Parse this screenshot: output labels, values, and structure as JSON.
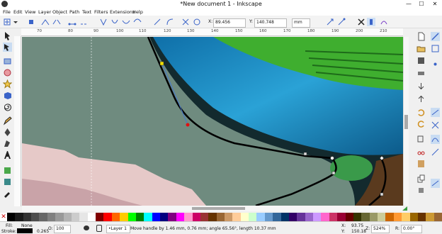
{
  "window": {
    "title": "*New document 1 - Inkscape",
    "minimize": "—",
    "maximize": "☐",
    "close": "✕"
  },
  "menu": [
    "File",
    "Edit",
    "View",
    "Layer",
    "Object",
    "Path",
    "Text",
    "Filters",
    "Extensions",
    "Help"
  ],
  "toolbar": {
    "x_label": "X:",
    "x_value": "89.456",
    "y_label": "Y:",
    "y_value": "140.748",
    "unit": "mm"
  },
  "ruler": {
    "ticks": [
      "70",
      "80",
      "90",
      "100",
      "110",
      "120",
      "130",
      "140",
      "150",
      "160",
      "170",
      "180",
      "190",
      "200",
      "210"
    ]
  },
  "status": {
    "fill_label": "Fill:",
    "fill_value": "None",
    "stroke_label": "Stroke:",
    "stroke_value": "0.265",
    "opacity_label": "O:",
    "opacity_value": "100",
    "layer": "•Layer 1",
    "message": "Move handle by 1.46 mm, 0.76 mm; angle 65.56°, length 10.37 mm",
    "x_label": "X:",
    "x_value": "93.75",
    "y_label": "Y:",
    "y_value": "150.18",
    "z_label": "Z:",
    "z_value": "524%",
    "r_label": "R:",
    "r_value": "0.00°"
  },
  "colors": {
    "accent": "#3a63c8",
    "canvas_bg": "#6f8b7f",
    "bird_blue": "#1f8fbf",
    "bird_green": "#3fae2f"
  },
  "palette": [
    "#000000",
    "#1a1a1a",
    "#333333",
    "#4d4d4d",
    "#666666",
    "#808080",
    "#999999",
    "#b3b3b3",
    "#cccccc",
    "#e6e6e6",
    "#ffffff",
    "#800000",
    "#ff0000",
    "#ff6600",
    "#ffcc00",
    "#00ff00",
    "#008000",
    "#00ffff",
    "#0000ff",
    "#000080",
    "#800080",
    "#ff00ff",
    "#ff99cc",
    "#cc0066",
    "#993333",
    "#663300",
    "#996633",
    "#cc9966",
    "#ffcc99",
    "#ffffcc",
    "#ccffcc",
    "#99ccff",
    "#6699cc",
    "#336699",
    "#003366",
    "#330066",
    "#663399",
    "#9966cc",
    "#cc99ff",
    "#ff66cc",
    "#cc3366",
    "#990033",
    "#660000",
    "#333300",
    "#666633",
    "#999966",
    "#cccc99",
    "#cc6600",
    "#ff9933",
    "#ffcc66",
    "#996600",
    "#663300",
    "#cc9933",
    "#996633"
  ]
}
